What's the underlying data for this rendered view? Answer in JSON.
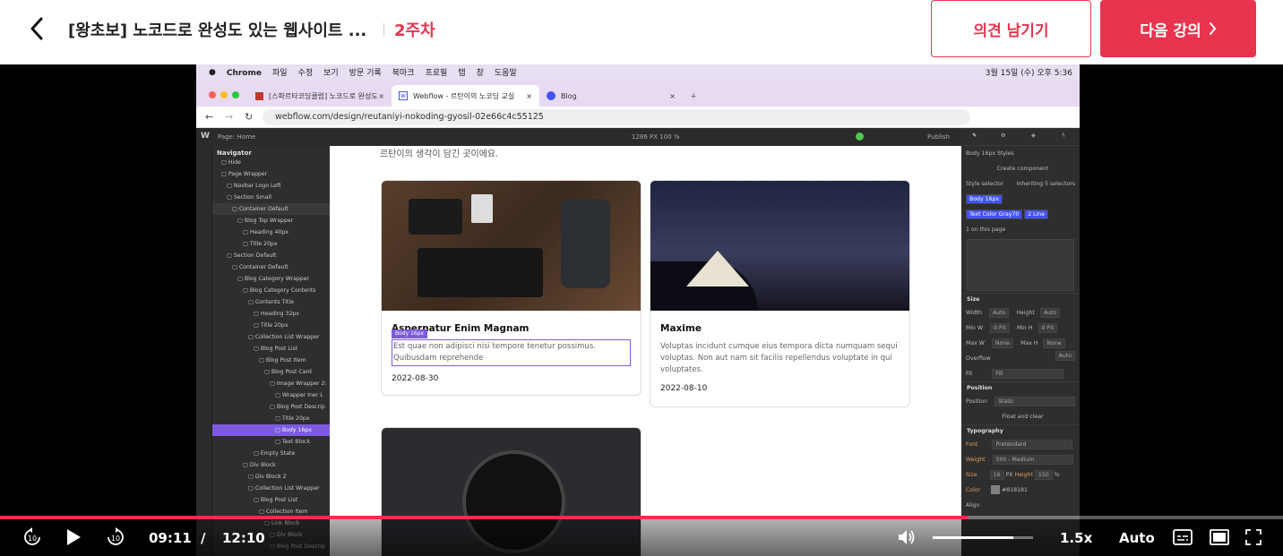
{
  "header": {
    "course_title": "[왕초보] 노코드로 완성도 있는 웹사이트 ...",
    "week": "2주차",
    "feedback_label": "의견 남기기",
    "next_label": "다음 강의"
  },
  "mac_menubar": {
    "items": [
      "Chrome",
      "파일",
      "수정",
      "보기",
      "방문 기록",
      "북마크",
      "프로필",
      "탭",
      "창",
      "도움말"
    ],
    "clock": "3월 15일 (수) 오후 5:36"
  },
  "browser": {
    "tabs": [
      {
        "label": "[스파르타코딩클럽] 노코드로 완성도"
      },
      {
        "label": "Webflow - 르탄이의 노코딩 교실"
      },
      {
        "label": "Blog"
      }
    ],
    "url": "webflow.com/design/reutaniyi-nokoding-gyosil-02e66c4c55125"
  },
  "webflow": {
    "page_label": "Page: Home",
    "viewport": "1286 PX  100 %",
    "publish": "Publish",
    "navigator_title": "Navigator",
    "nav_items": [
      {
        "label": "Hide",
        "indent": 1
      },
      {
        "label": "Page Wrapper",
        "indent": 1
      },
      {
        "label": "Navbar Logo Left",
        "indent": 2
      },
      {
        "label": "Section Small",
        "indent": 2
      },
      {
        "label": "Container Default",
        "indent": 3,
        "state": "hl"
      },
      {
        "label": "Blog Top Wrapper",
        "indent": 4
      },
      {
        "label": "Heading 40px",
        "indent": 5
      },
      {
        "label": "Title 20px",
        "indent": 5
      },
      {
        "label": "Section Default",
        "indent": 2
      },
      {
        "label": "Container Default",
        "indent": 3
      },
      {
        "label": "Blog Category Wrapper",
        "indent": 4
      },
      {
        "label": "Blog Category Contents",
        "indent": 5
      },
      {
        "label": "Contents Title",
        "indent": 6
      },
      {
        "label": "Heading 32px",
        "indent": 7
      },
      {
        "label": "Title 20px",
        "indent": 7
      },
      {
        "label": "Collection List Wrapper",
        "indent": 6
      },
      {
        "label": "Blog Post List",
        "indent": 7
      },
      {
        "label": "Blog Post Item",
        "indent": 8
      },
      {
        "label": "Blog Post Card",
        "indent": 9
      },
      {
        "label": "Image Wrapper 2:",
        "indent": 10
      },
      {
        "label": "Wrapper Iner L",
        "indent": 11
      },
      {
        "label": "Blog Post Descrip",
        "indent": 10
      },
      {
        "label": "Title 20px",
        "indent": 11
      },
      {
        "label": "Body 16px",
        "indent": 11,
        "state": "sel"
      },
      {
        "label": "Text Block",
        "indent": 11
      },
      {
        "label": "Empty State",
        "indent": 7
      },
      {
        "label": "Div Block",
        "indent": 5
      },
      {
        "label": "Div Block 2",
        "indent": 6
      },
      {
        "label": "Collection List Wrapper",
        "indent": 6
      },
      {
        "label": "Blog Post List",
        "indent": 7
      },
      {
        "label": "Collection Item",
        "indent": 8
      },
      {
        "label": "Link Block",
        "indent": 9
      },
      {
        "label": "Div Block",
        "indent": 10
      },
      {
        "label": "Blog Post Descrip",
        "indent": 10
      }
    ]
  },
  "canvas": {
    "intro": "르탄이의 생각이 담긴 곳이에요.",
    "selection_tag": "Body 16px",
    "cards": [
      {
        "title": "Aspernatur Enim Magnam",
        "body": "Est quae non adipisci nisi tempore tenetur possimus. Quibusdam reprehende",
        "date": "2022-08-30"
      },
      {
        "title": "Maxime",
        "body": "Voluptas incidunt cumque eius tempora dicta numquam sequi voluptas. Non aut nam sit facilis repellendus voluptate in qui voluptates.",
        "date": "2022-08-10"
      }
    ]
  },
  "style_panel": {
    "element": "Body 16px Styles",
    "create_component": "Create component",
    "style_selector": "Style selector",
    "inheriting": "Inheriting 5 selectors",
    "chips": [
      "Body 16px",
      "Text Color Gray70",
      "2 Line"
    ],
    "on_page": "1 on this page",
    "sections": {
      "size": "Size",
      "position": "Position",
      "typography": "Typography"
    },
    "size_rows": [
      {
        "a": "Width",
        "av": "Auto",
        "b": "Height",
        "bv": "Auto"
      },
      {
        "a": "Min W",
        "av": "0  PX",
        "b": "Min H",
        "bv": "0  PX"
      },
      {
        "a": "Max W",
        "av": "None",
        "b": "Max H",
        "bv": "None"
      }
    ],
    "overflow_label": "Overflow",
    "overflow_auto": "Auto",
    "fit_label": "Fit",
    "fit_value": "Fill",
    "position_label": "Position",
    "position_value": "Static",
    "float_clear": "Float and clear",
    "font_label": "Font",
    "font_value": "Pretendard",
    "weight_label": "Weight",
    "weight_value": "500 - Medium",
    "size_label": "Size",
    "size_value": "16",
    "size_unit": "PX",
    "height_label": "Height",
    "height_value": "150",
    "height_unit": "%",
    "color_label": "Color",
    "color_value": "#818181",
    "align_label": "Align"
  },
  "player": {
    "current_time": "09:11",
    "slash": "/",
    "total_time": "12:10",
    "speed": "1.5x",
    "quality": "Auto",
    "progress": 0.755,
    "volume": 0.8
  },
  "colors": {
    "accent": "#e8344e",
    "webflow_select": "#7c5ae0"
  }
}
